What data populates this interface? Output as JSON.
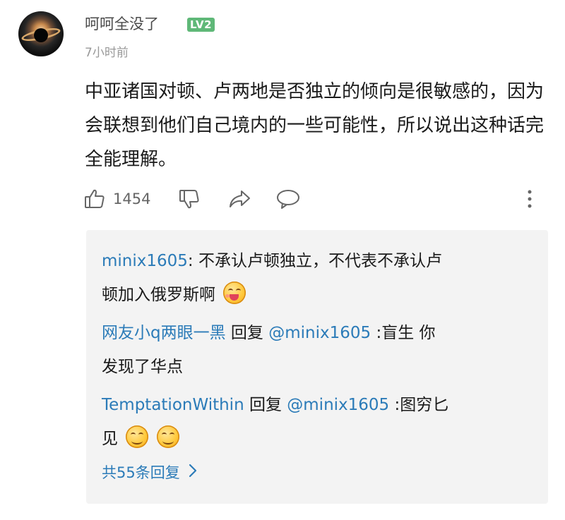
{
  "comment": {
    "username": "呵呵全没了",
    "level": "LV2",
    "time": "7小时前",
    "text": "中亚诸国对顿、卢两地是否独立的倾向是很敏感的，因为会联想到他们自己境内的一些可能性，所以说出这种话完全能理解。",
    "like_count": "1454",
    "icons": [
      "thumbs-up-icon",
      "thumbs-down-icon",
      "share-icon",
      "comment-icon",
      "more-icon"
    ]
  },
  "replies": [
    {
      "user": "minix1605",
      "reply_to": "",
      "text_line1": ": 不承认卢顿独立，不代表不承认卢",
      "text_line2": "顿加入俄罗斯啊",
      "emoji": [
        "tongue-out-emoji"
      ]
    },
    {
      "user": "网友小q两眼一黑",
      "reply_word": " 回复 ",
      "reply_to": "@minix1605",
      "text_line1": " :盲生 你",
      "text_line2": "发现了华点",
      "emoji": []
    },
    {
      "user": "TemptationWithin",
      "reply_word": " 回复 ",
      "reply_to": "@minix1605",
      "text_line1": " :图穷匕",
      "text_line2": "见",
      "emoji": [
        "grin-emoji",
        "grin-emoji"
      ]
    }
  ],
  "more_replies_label": "共55条回复",
  "colors": {
    "link": "#2b7bb8",
    "badge": "#5fb878",
    "reply_bg": "#f3f3f3"
  }
}
